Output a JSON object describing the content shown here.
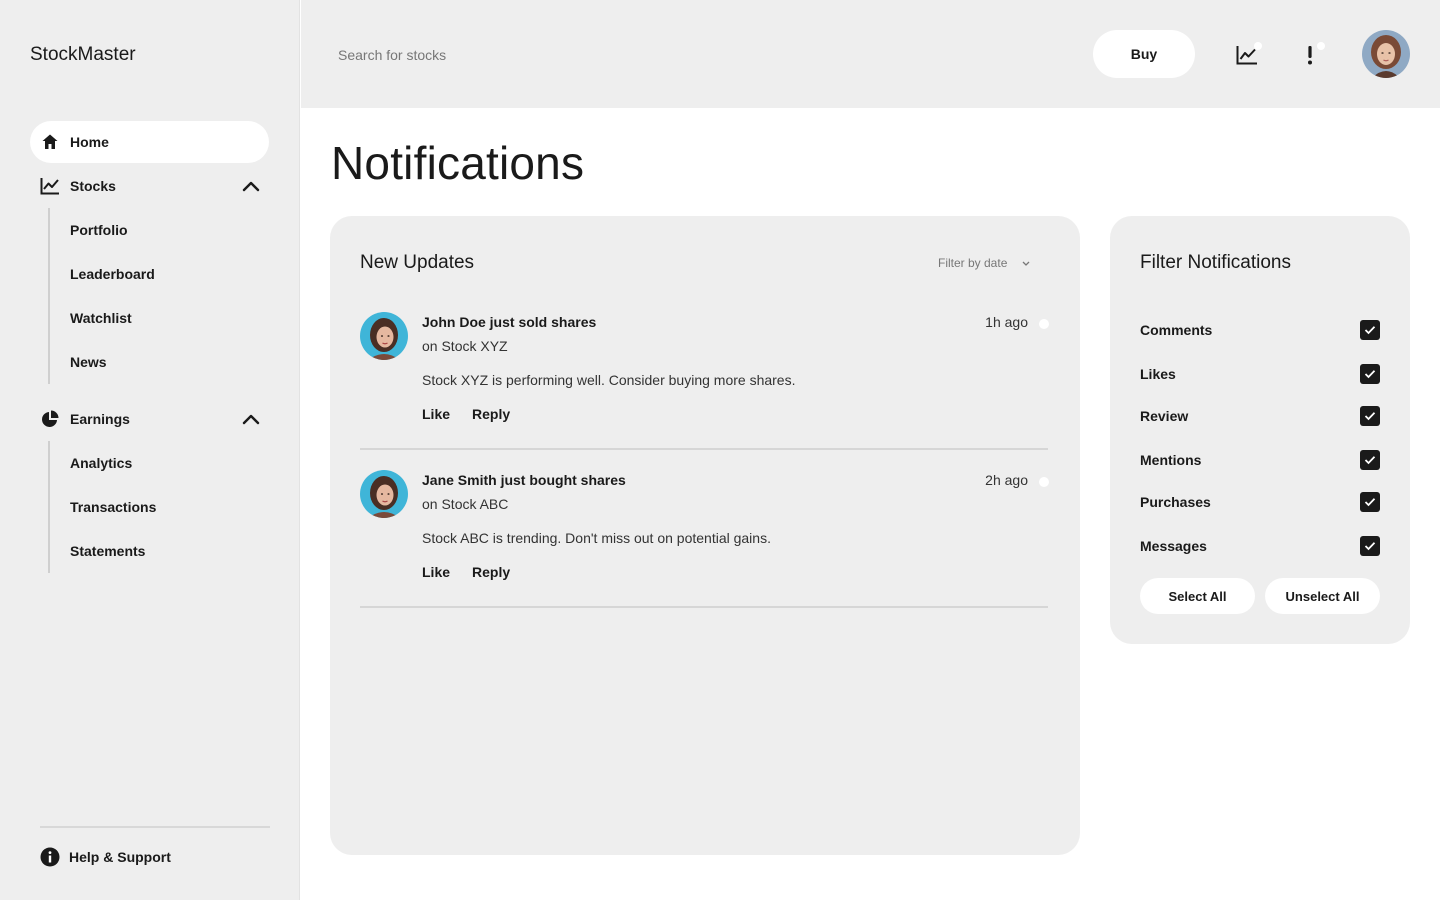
{
  "app": {
    "brand": "StockMaster"
  },
  "sidebar": {
    "items": [
      {
        "label": "Home",
        "icon": "home-icon",
        "active": true
      },
      {
        "label": "Stocks",
        "icon": "chart-line-icon",
        "expanded": true,
        "children": [
          "Portfolio",
          "Leaderboard",
          "Watchlist",
          "News"
        ]
      },
      {
        "label": "Earnings",
        "icon": "pie-chart-icon",
        "expanded": true,
        "children": [
          "Analytics",
          "Transactions",
          "Statements"
        ]
      }
    ],
    "help_label": "Help & Support",
    "help_icon": "info-icon"
  },
  "topbar": {
    "search_placeholder": "Search for stocks",
    "buy_label": "Buy",
    "icons": [
      "chart-line-icon",
      "alert-icon"
    ]
  },
  "page": {
    "title": "Notifications"
  },
  "updates": {
    "title": "New Updates",
    "filter_label": "Filter by date",
    "items": [
      {
        "headline": "John Doe just sold shares",
        "sub": "on Stock XYZ",
        "time": "1h ago",
        "body": "Stock XYZ is performing well. Consider buying more shares.",
        "like": "Like",
        "reply": "Reply"
      },
      {
        "headline": "Jane Smith just bought shares",
        "sub": "on Stock ABC",
        "time": "2h ago",
        "body": "Stock ABC is trending. Don't miss out on potential gains.",
        "like": "Like",
        "reply": "Reply"
      }
    ]
  },
  "filters": {
    "title": "Filter Notifications",
    "options": [
      {
        "label": "Comments",
        "checked": true
      },
      {
        "label": "Likes",
        "checked": true
      },
      {
        "label": "Review",
        "checked": true
      },
      {
        "label": "Mentions",
        "checked": true
      },
      {
        "label": "Purchases",
        "checked": true
      },
      {
        "label": "Messages",
        "checked": true
      }
    ],
    "select_all": "Select All",
    "unselect_all": "Unselect All"
  },
  "colors": {
    "panel": "#eeeeee",
    "accent": "#1a1a1a",
    "surface": "#ffffff"
  }
}
